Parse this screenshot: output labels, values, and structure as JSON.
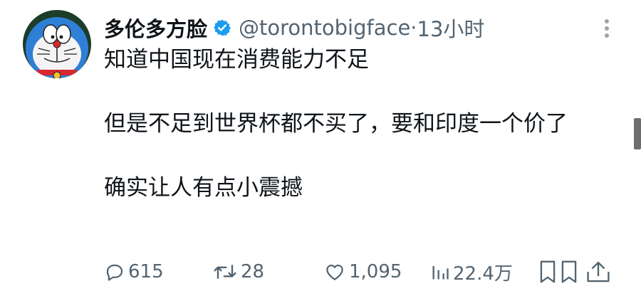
{
  "tweet": {
    "display_name": "多伦多方脸",
    "handle": "@torontobigface",
    "separator": " · ",
    "time": "13小时",
    "lines": [
      "知道中国现在消费能力不足",
      "",
      "但是不足到世界杯都不买了，要和印度一个价了",
      "",
      "确实让人有点小震撼"
    ]
  },
  "actions": {
    "replies": "615",
    "retweets": "28",
    "likes": "1,095",
    "views": "22.4万"
  },
  "icons": {
    "verified": "verified-badge-icon",
    "more": "more-vertical-icon",
    "reply": "reply-icon",
    "retweet": "retweet-icon",
    "like": "heart-icon",
    "views": "analytics-icon",
    "bookmark": "bookmark-icon",
    "share": "share-icon"
  },
  "colors": {
    "text": "#0f1419",
    "secondary": "#536471",
    "verified": "#1d9bf0"
  }
}
